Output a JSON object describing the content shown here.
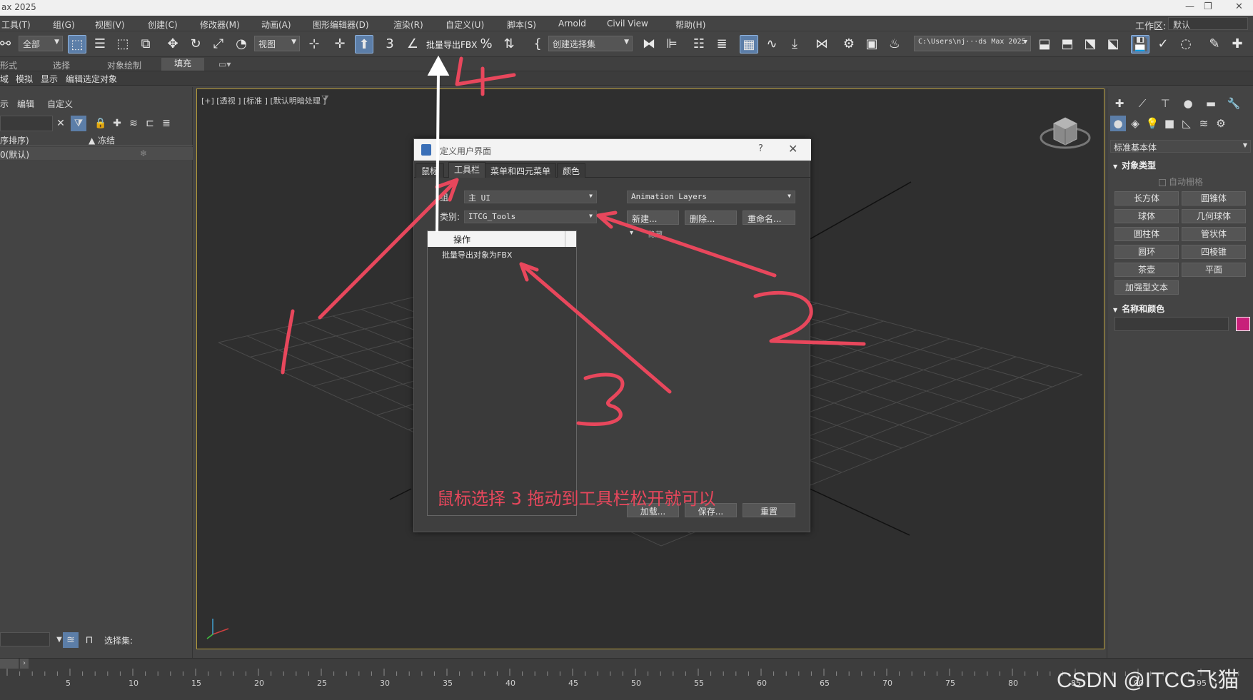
{
  "window": {
    "title": "ax 2025"
  },
  "menubar": {
    "items": [
      "工具(T)",
      "组(G)",
      "视图(V)",
      "创建(C)",
      "修改器(M)",
      "动画(A)",
      "图形编辑器(D)",
      "渲染(R)",
      "自定义(U)",
      "脚本(S)",
      "Arnold",
      "Civil View",
      "帮助(H)"
    ],
    "workspace_label": "工作区:",
    "workspace_value": "默认"
  },
  "toolbar": {
    "filter_value": "全部",
    "refcoord_value": "视图",
    "batch_export_label": "批量导出FBX",
    "selection_set_value": "创建选择集",
    "path_value": "C:\\Users\\nj···ds Max 2025"
  },
  "ribbon": {
    "tabs": [
      "形式",
      "选择",
      "对象绘制",
      "填充"
    ]
  },
  "ribbon2": {
    "items": [
      "域",
      "模拟",
      "显示",
      "编辑选定对象"
    ]
  },
  "scene_explorer": {
    "tabs": [
      "示",
      "编辑",
      "自定义"
    ],
    "col_sort": "序排序)",
    "col_frozen": "▲ 冻结",
    "row0_name": "0(默认)",
    "selection_set_label": "选择集:"
  },
  "viewport": {
    "label": "[+] [透视 ] [标准 ] [默认明暗处理 ]"
  },
  "dialog": {
    "title": "定义用户界面",
    "help": "?",
    "tabs": [
      "鼠标",
      "工具栏",
      "菜单和四元菜单",
      "颜色"
    ],
    "group_label": "组:",
    "group_value": "主 UI",
    "category_label": "类别:",
    "category_value": "ITCG_Tools",
    "toolbar_value": "Animation Layers",
    "btn_new": "新建...",
    "btn_delete": "删除...",
    "btn_rename": "重命名...",
    "checkbox_partial": "隐藏",
    "list_header": "操作",
    "list_items": [
      "批量导出对象为FBX"
    ],
    "btn_load": "加载...",
    "btn_save": "保存...",
    "btn_reset": "重置",
    "instruction_text": "鼠标选择 3 拖动到工具栏松开就可以"
  },
  "command_panel": {
    "category_value": "标准基本体",
    "section_object_type": "对象类型",
    "autogrid_label": "自动栅格",
    "primitives": [
      "长方体",
      "圆锥体",
      "球体",
      "几何球体",
      "圆柱体",
      "管状体",
      "圆环",
      "四棱锥",
      "茶壶",
      "平面",
      "加强型文本"
    ],
    "section_name_color": "名称和颜色",
    "object_color": "#c8207a"
  },
  "timeline": {
    "ticks": [
      5,
      10,
      15,
      20,
      25,
      30,
      35,
      40,
      45,
      50,
      55,
      60,
      65,
      70,
      75,
      80,
      85,
      90,
      95
    ]
  },
  "annotations": {
    "numbers": [
      "1",
      "2",
      "3",
      "4"
    ],
    "color": "#e8475c"
  },
  "watermark": "CSDN @ITCG飞猫"
}
